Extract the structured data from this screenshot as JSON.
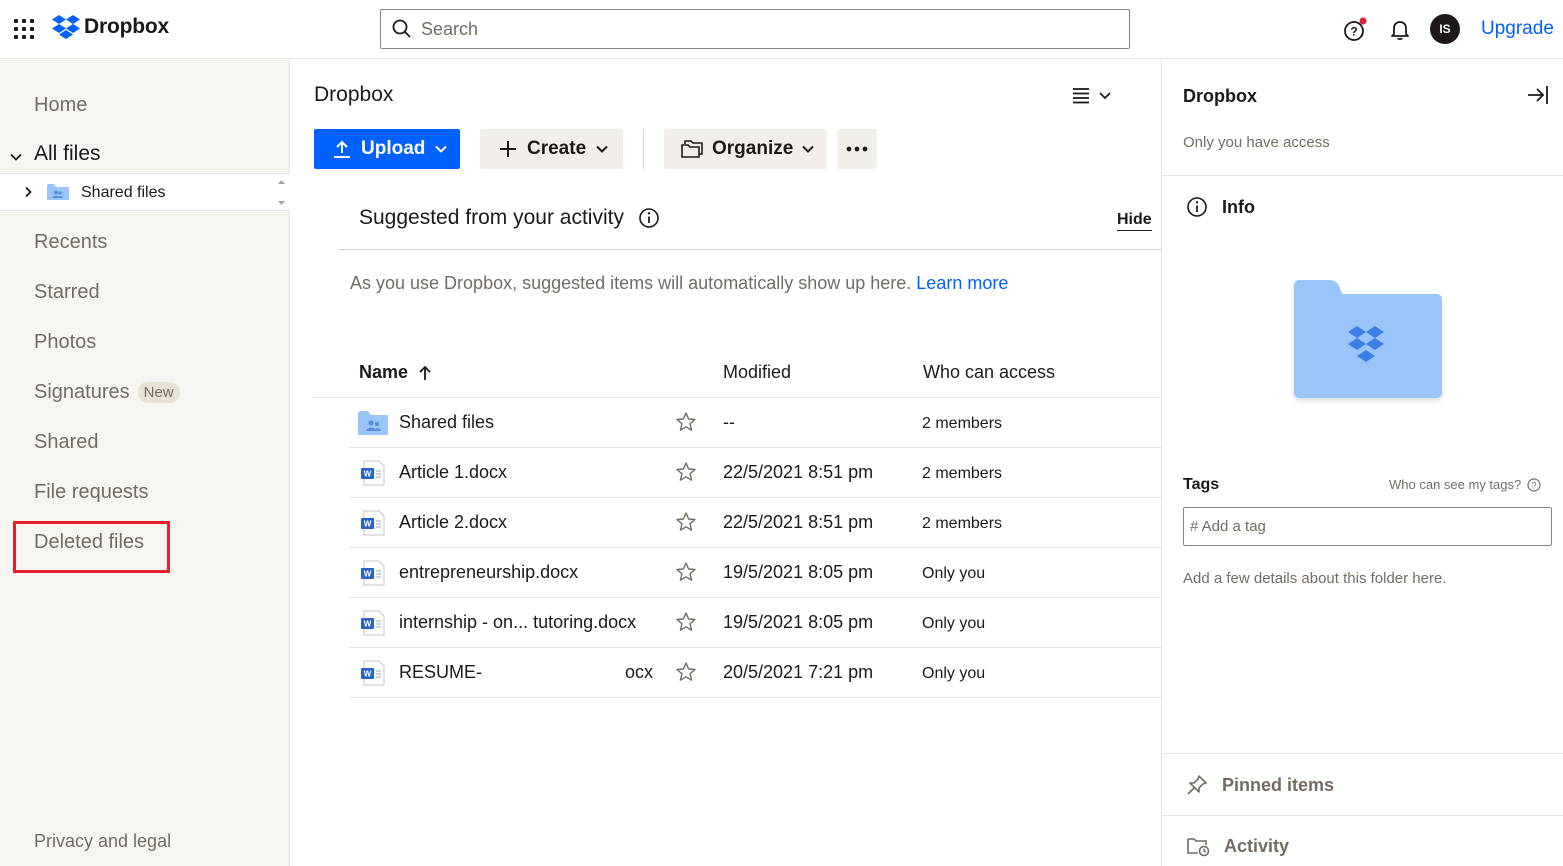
{
  "topbar": {
    "app_name": "Dropbox",
    "search_placeholder": "Search",
    "avatar_initials": "IS",
    "upgrade_label": "Upgrade",
    "notification_dot_color": "#d3273e"
  },
  "sidebar": {
    "items": [
      {
        "label": "Home"
      },
      {
        "label": "All files"
      },
      {
        "label": "Recents"
      },
      {
        "label": "Starred"
      },
      {
        "label": "Photos"
      },
      {
        "label": "Signatures",
        "badge": "New"
      },
      {
        "label": "Shared"
      },
      {
        "label": "File requests"
      },
      {
        "label": "Deleted files",
        "highlighted": true
      }
    ],
    "tree_item": "Shared files",
    "footer": "Privacy and legal",
    "highlight_color": "#e5202e"
  },
  "main": {
    "title": "Dropbox",
    "toolbar": {
      "upload": "Upload",
      "create": "Create",
      "organize": "Organize"
    },
    "suggested": {
      "heading": "Suggested from your activity",
      "hide": "Hide",
      "text": "As you use Dropbox, suggested items will automatically show up here.",
      "learn_more": "Learn more"
    },
    "table": {
      "columns": {
        "name": "Name",
        "modified": "Modified",
        "access": "Who can access"
      },
      "rows": [
        {
          "name": "Shared files",
          "suffix": "",
          "modified": "--",
          "access": "2 members",
          "type": "shared-folder"
        },
        {
          "name": "Article 1.docx",
          "suffix": "",
          "modified": "22/5/2021 8:51 pm",
          "access": "2 members",
          "type": "word"
        },
        {
          "name": "Article 2.docx",
          "suffix": "",
          "modified": "22/5/2021 8:51 pm",
          "access": "2 members",
          "type": "word"
        },
        {
          "name": "entrepreneurship.docx",
          "suffix": "",
          "modified": "19/5/2021 8:05 pm",
          "access": "Only you",
          "type": "word"
        },
        {
          "name": "internship - on... tutoring.docx",
          "suffix": "",
          "modified": "19/5/2021 8:05 pm",
          "access": "Only you",
          "type": "word"
        },
        {
          "name": "RESUME-",
          "suffix": "ocx",
          "modified": "20/5/2021 7:21 pm",
          "access": "Only you",
          "type": "word"
        }
      ]
    }
  },
  "right_panel": {
    "title": "Dropbox",
    "access": "Only you have access",
    "info": "Info",
    "tags_label": "Tags",
    "who_can_see": "Who can see my tags?",
    "tag_placeholder": "# Add a tag",
    "details": "Add a few details about this folder here.",
    "pinned": "Pinned items",
    "activity": "Activity"
  },
  "colors": {
    "accent": "#0061fe",
    "folder": "#9ac5f8"
  }
}
